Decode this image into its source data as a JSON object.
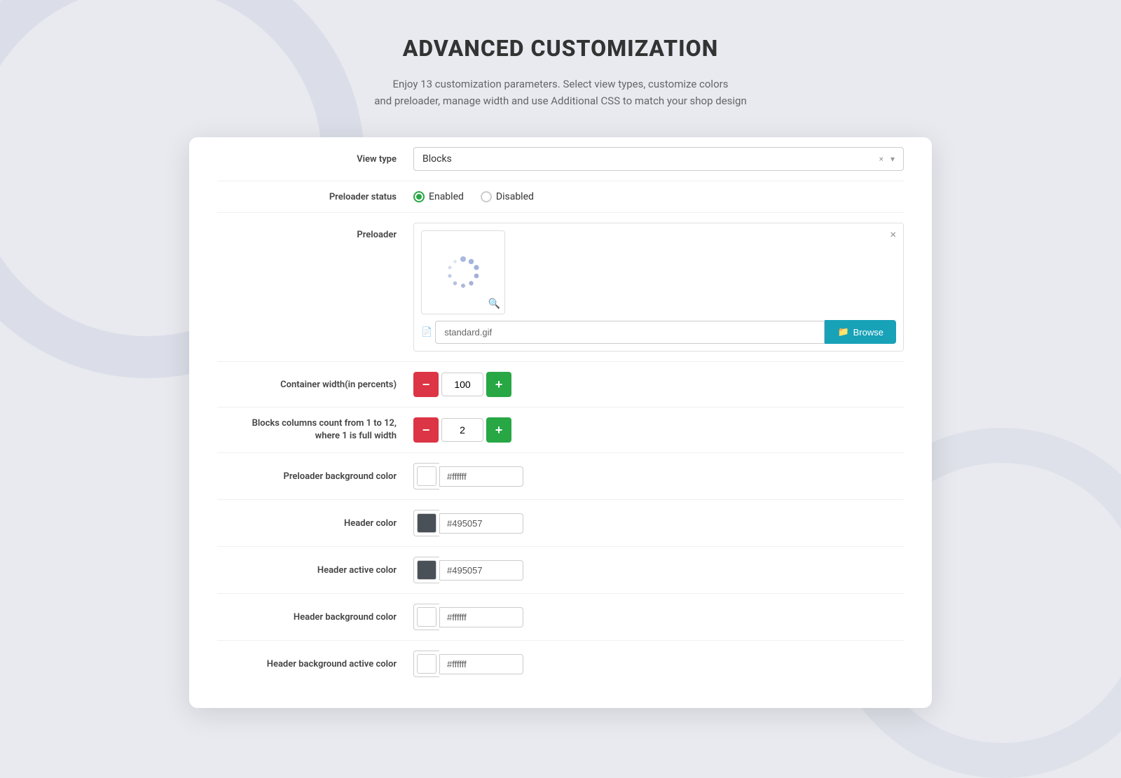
{
  "header": {
    "title": "ADVANCED CUSTOMIZATION",
    "subtitle_line1": "Enjoy 13 customization parameters. Select view types, customize colors",
    "subtitle_line2": "and preloader, manage width and use Additional CSS to match your shop design"
  },
  "form": {
    "view_type_label": "View type",
    "view_type_value": "Blocks",
    "preloader_status_label": "Preloader status",
    "preloader_enabled": "Enabled",
    "preloader_disabled": "Disabled",
    "preloader_label": "Preloader",
    "preloader_file": "standard.gif",
    "browse_label": "Browse",
    "container_width_label": "Container width(in percents)",
    "container_width_value": "100",
    "blocks_columns_label": "Blocks columns count from 1 to 12,\nwhere 1 is full width",
    "blocks_columns_value": "2",
    "preloader_bg_label": "Preloader background color",
    "preloader_bg_value": "#ffffff",
    "header_color_label": "Header color",
    "header_color_value": "#495057",
    "header_active_color_label": "Header active color",
    "header_active_color_value": "#495057",
    "header_bg_color_label": "Header background color",
    "header_bg_color_value": "#ffffff",
    "header_bg_active_color_label": "Header background active color",
    "header_bg_active_color_value": "#ffffff"
  },
  "colors": {
    "minus_btn": "#dc3545",
    "plus_btn": "#28a745",
    "enabled_dot": "#28a745",
    "browse_btn": "#17a2b8",
    "header_swatch": "#495057"
  }
}
